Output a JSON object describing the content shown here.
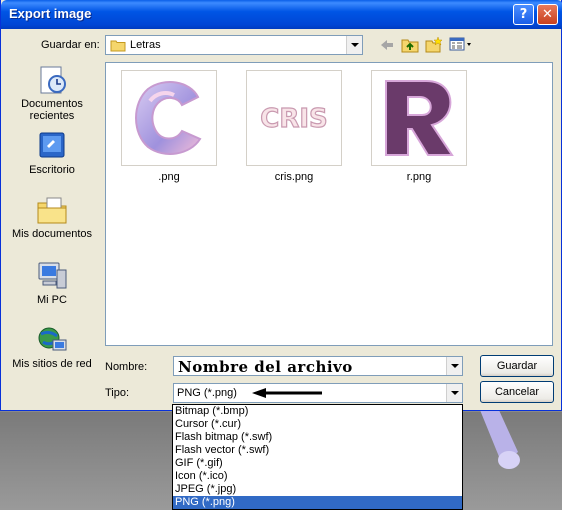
{
  "window": {
    "title": "Export image",
    "help_icon": "?",
    "close_icon": "✕"
  },
  "toolbar": {
    "look_in_label": "Guardar en:",
    "look_in_value": "Letras",
    "icons": [
      "back-icon",
      "up-folder-icon",
      "new-folder-icon",
      "views-icon"
    ]
  },
  "places": [
    {
      "label": "Documentos recientes",
      "icon": "recent-documents-icon"
    },
    {
      "label": "Escritorio",
      "icon": "desktop-icon"
    },
    {
      "label": "Mis documentos",
      "icon": "my-documents-icon"
    },
    {
      "label": "Mi PC",
      "icon": "my-computer-icon"
    },
    {
      "label": "Mis sitios de red",
      "icon": "network-places-icon"
    }
  ],
  "files": [
    {
      "name": ".png",
      "preview": "C"
    },
    {
      "name": "cris.png",
      "preview": "CRIS"
    },
    {
      "name": "r.png",
      "preview": "R"
    }
  ],
  "form": {
    "filename_label": "Nombre:",
    "filename_value": "Nombre del archivo",
    "type_label": "Tipo:",
    "type_value": "PNG (*.png)"
  },
  "buttons": {
    "save": "Guardar",
    "cancel": "Cancelar"
  },
  "type_options": [
    "Bitmap (*.bmp)",
    "Cursor (*.cur)",
    "Flash bitmap (*.swf)",
    "Flash vector (*.swf)",
    "GIF (*.gif)",
    "Icon (*.ico)",
    "JPEG (*.jpg)",
    "PNG (*.png)"
  ],
  "selected_type_index": 7,
  "colors": {
    "titlebar": "#0055e5",
    "dialog": "#ece9d8",
    "selection": "#316ac5"
  }
}
